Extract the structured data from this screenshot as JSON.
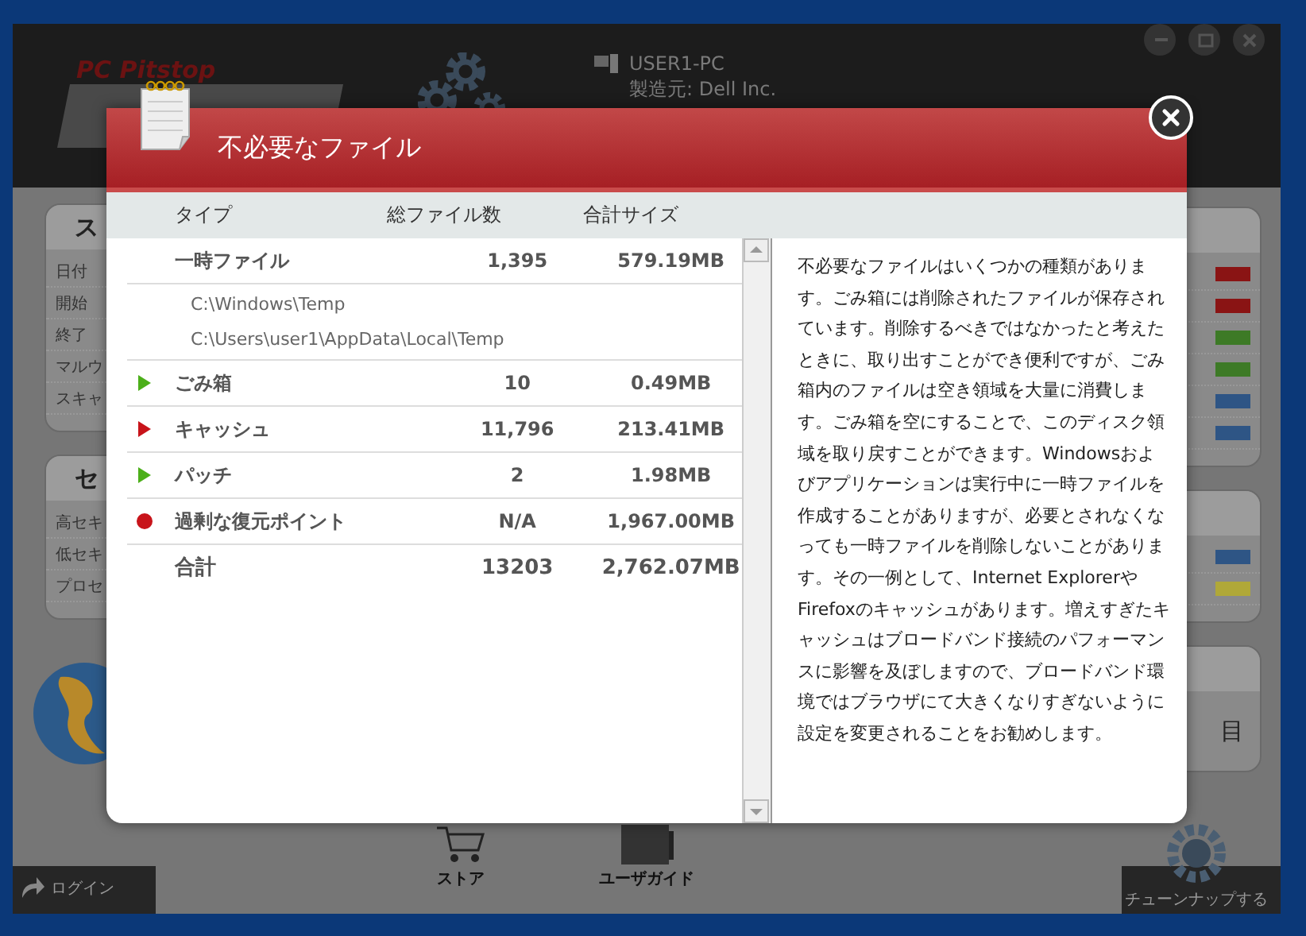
{
  "app": {
    "brand": "PC Pitstop",
    "computer": {
      "name": "USER1-PC",
      "maker": "製造元: Dell Inc."
    }
  },
  "left_panels": [
    {
      "title": "ス",
      "rows": [
        "日付",
        "開始",
        "終了",
        "マルウ",
        "スキャ"
      ]
    },
    {
      "title": "セ",
      "rows": [
        "高セキ",
        "低セキ",
        "プロセ"
      ]
    }
  ],
  "right_panels": [
    {
      "bars": [
        {
          "color": "#8a1414"
        },
        {
          "color": "#8a1414"
        },
        {
          "color": "#3d7a26"
        },
        {
          "color": "#3d7a26"
        },
        {
          "color": "#2e5585"
        },
        {
          "color": "#2e5585"
        }
      ]
    },
    {
      "bars": [
        {
          "color": "#2e5585"
        },
        {
          "color": "#b0a838"
        }
      ]
    },
    {
      "text": "目"
    }
  ],
  "bottom_bar": {
    "login": "ログイン",
    "store": "ストア",
    "guide": "ユーザガイド",
    "tuneup": "チューンナップする"
  },
  "dialog": {
    "title": "不必要なファイル",
    "columns": [
      "タイプ",
      "総ファイル数",
      "合計サイズ"
    ],
    "rows": [
      {
        "kind": "plain",
        "name": "一時ファイル",
        "count": "1,395",
        "size": "579.19MB",
        "paths": [
          "C:\\Windows\\Temp",
          "C:\\Users\\user1\\AppData\\Local\\Temp"
        ]
      },
      {
        "kind": "triangle",
        "color": "#4caf1a",
        "name": "ごみ箱",
        "count": "10",
        "size": "0.49MB"
      },
      {
        "kind": "triangle",
        "color": "#c8141a",
        "name": "キャッシュ",
        "count": "11,796",
        "size": "213.41MB"
      },
      {
        "kind": "triangle",
        "color": "#4caf1a",
        "name": "パッチ",
        "count": "2",
        "size": "1.98MB"
      },
      {
        "kind": "dot",
        "color": "#c8141a",
        "name": "過剰な復元ポイント",
        "count": "N/A",
        "size": "1,967.00MB"
      }
    ],
    "total": {
      "name": "合計",
      "count": "13203",
      "size": "2,762.07MB"
    },
    "description": "不必要なファイルはいくつかの種類があります。ごみ箱には削除されたファイルが保存されています。削除するべきではなかったと考えたときに、取り出すことができ便利ですが、ごみ箱内のファイルは空き領域を大量に消費します。ごみ箱を空にすることで、このディスク領域を取り戻すことができます。Windowsおよびアプリケーションは実行中に一時ファイルを作成することがありますが、必要とされなくなっても一時ファイルを削除しないことがあります。その一例として、Internet ExplorerやFirefoxのキャッシュがあります。増えすぎたキャッシュはブロードバンド接続のパフォーマンスに影響を及ぼしますので、ブロードバンド環境ではブラウザにて大きくなりすぎないように設定を変更されることをお勧めします。"
  }
}
